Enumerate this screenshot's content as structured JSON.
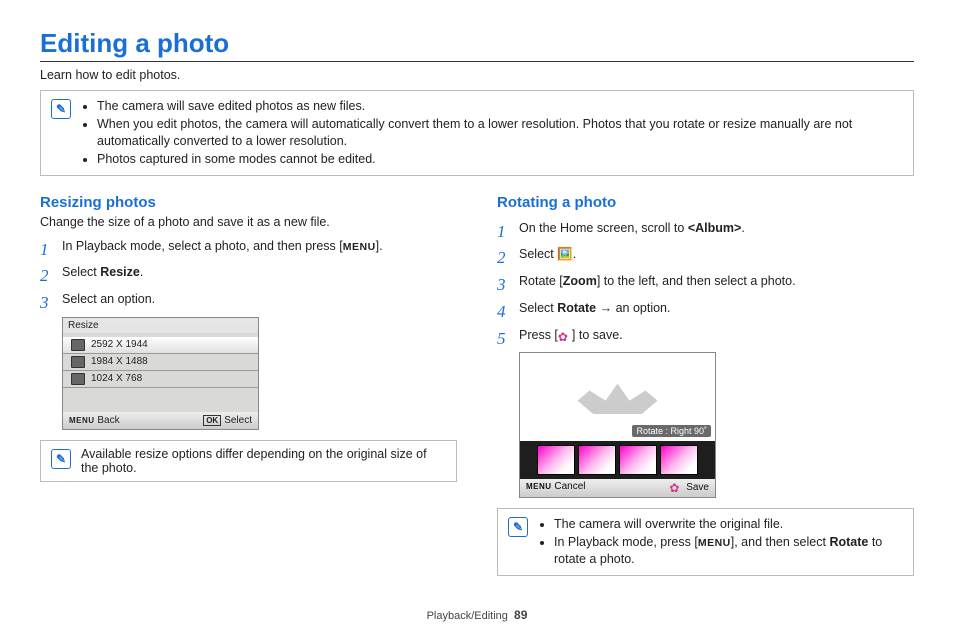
{
  "title": "Editing a photo",
  "intro": "Learn how to edit photos.",
  "top_notes": [
    "The camera will save edited photos as new files.",
    "When you edit photos, the camera will automatically convert them to a lower resolution. Photos that you rotate or resize manually are not automatically converted to a lower resolution.",
    "Photos captured in some modes cannot be edited."
  ],
  "left": {
    "heading": "Resizing photos",
    "sub": "Change the size of a photo and save it as a new file.",
    "steps": {
      "s1_a": "In Playback mode, select a photo, and then press [",
      "menu": "MENU",
      "s1_b": "].",
      "s2_a": "Select ",
      "s2_b": "Resize",
      "s2_c": ".",
      "s3": "Select an option."
    },
    "dialog": {
      "title": "Resize",
      "rows": [
        "2592 X 1944",
        "1984 X 1488",
        "1024 X 768"
      ],
      "back": "Back",
      "select": "Select",
      "menu_small": "MENU",
      "ok": "OK"
    },
    "note": "Available resize options differ depending on the original size of the photo."
  },
  "right": {
    "heading": "Rotating a photo",
    "steps": {
      "s1_a": "On the Home screen, scroll to ",
      "s1_b": "<Album>",
      "s1_c": ".",
      "s2": "Select ",
      "s2_b": ".",
      "s3_a": "Rotate [",
      "s3_b": "Zoom",
      "s3_c": "] to the left, and then select a photo.",
      "s4_a": "Select ",
      "s4_b": "Rotate",
      "s4_c": " → an option.",
      "s5_a": "Press [",
      "s5_b": "] to save."
    },
    "preview": {
      "tooltip": "Rotate : Right 90˚",
      "cancel": "Cancel",
      "save": "Save",
      "menu_small": "MENU"
    },
    "notes": {
      "n1": "The camera will overwrite the original file.",
      "n2_a": "In Playback mode, press [",
      "n2_menu": "MENU",
      "n2_b": "], and then select ",
      "n2_c": "Rotate",
      "n2_d": " to rotate a photo."
    }
  },
  "footer": {
    "section": "Playback/Editing",
    "page": "89"
  }
}
